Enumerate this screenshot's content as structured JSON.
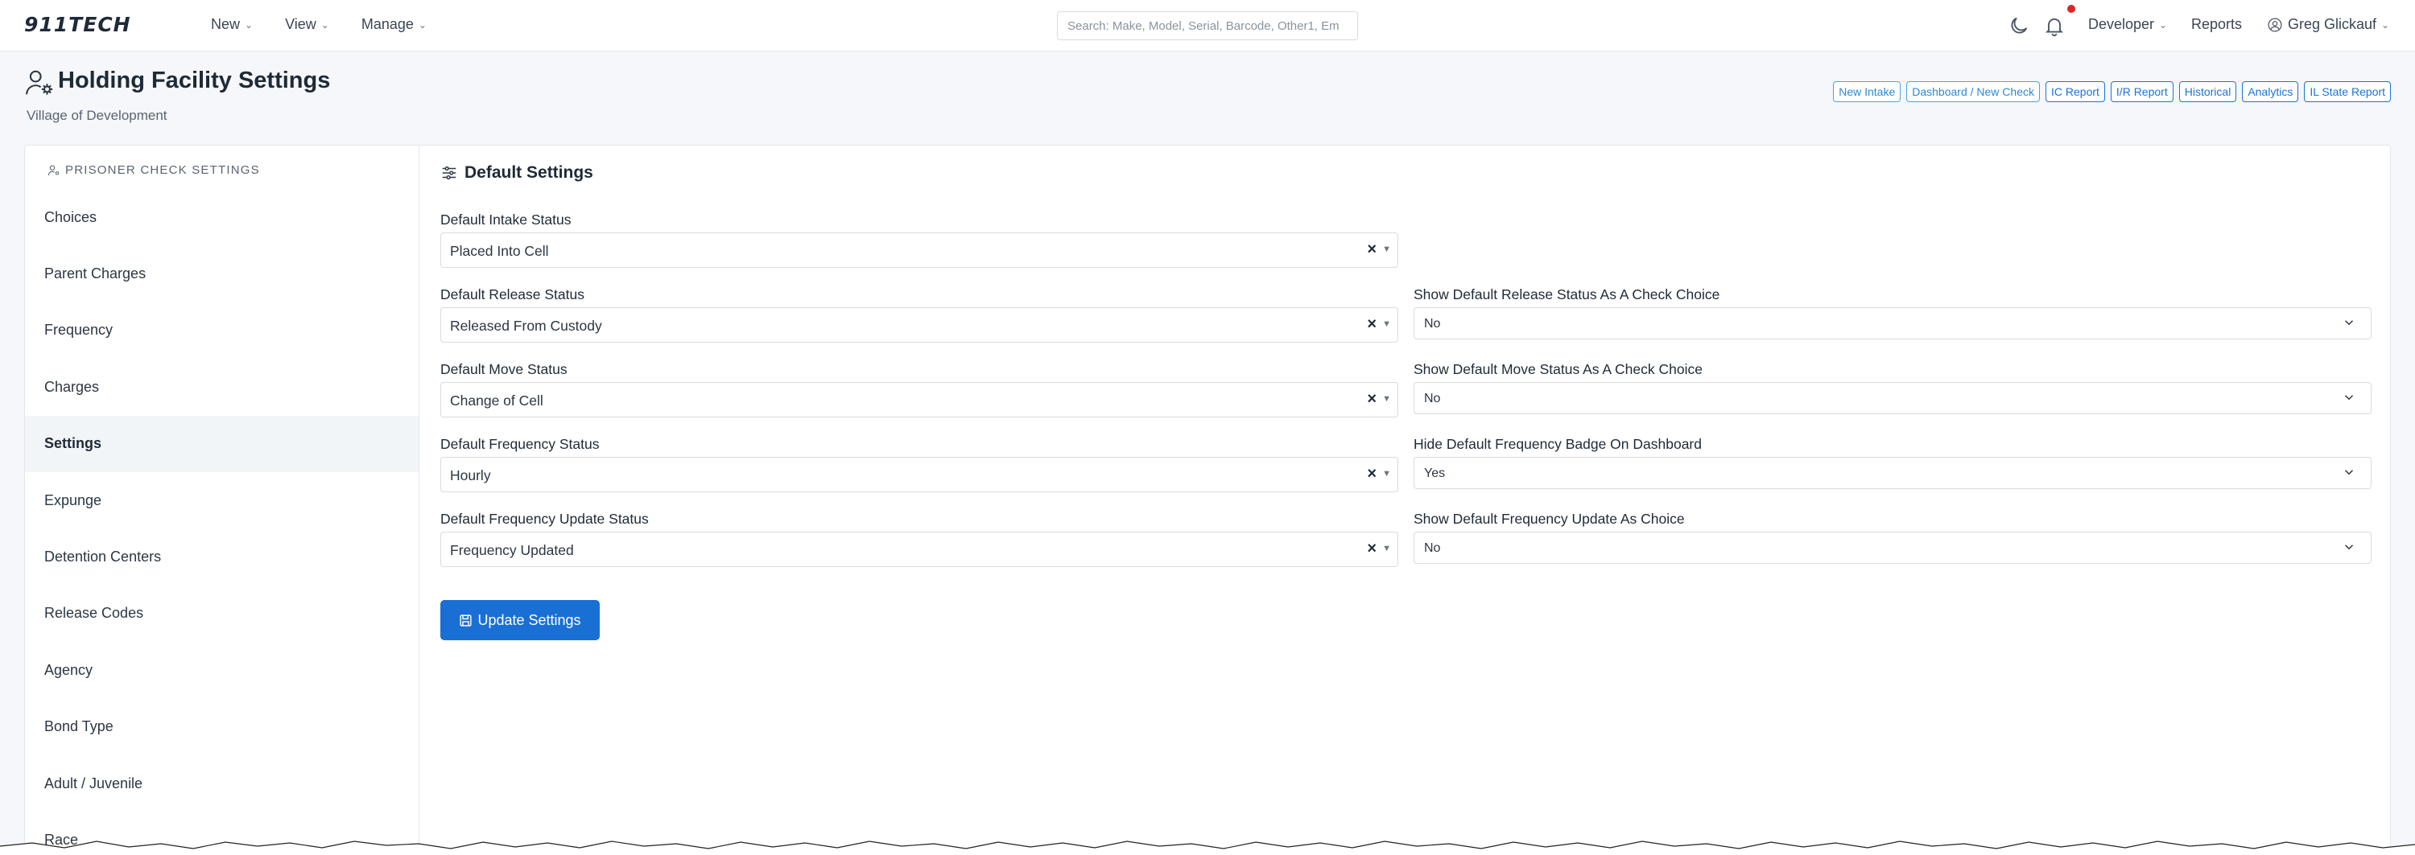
{
  "nav": {
    "logo": "911TECH",
    "menu": [
      "New",
      "View",
      "Manage"
    ],
    "search_placeholder": "Search: Make, Model, Serial, Barcode, Other1, Em",
    "developer": "Developer",
    "reports": "Reports",
    "user": "Greg Glickauf"
  },
  "page": {
    "title": "Holding Facility Settings",
    "subtitle": "Village of Development",
    "quick_links": [
      "New Intake",
      "Dashboard / New Check",
      "IC Report",
      "I/R Report",
      "Historical",
      "Analytics",
      "IL State Report"
    ]
  },
  "sidebar": {
    "header": "PRISONER CHECK SETTINGS",
    "items": [
      "Choices",
      "Parent Charges",
      "Frequency",
      "Charges",
      "Settings",
      "Expunge",
      "Detention Centers",
      "Release Codes",
      "Agency",
      "Bond Type",
      "Adult / Juvenile",
      "Race"
    ],
    "active": "Settings"
  },
  "content": {
    "title": "Default Settings",
    "intake_label": "Default Intake Status",
    "intake_value": "Placed Into Cell",
    "release_label": "Default Release Status",
    "release_value": "Released From Custody",
    "move_label": "Default Move Status",
    "move_value": "Change of Cell",
    "freq_label": "Default Frequency Status",
    "freq_value": "Hourly",
    "freq_update_label": "Default Frequency Update Status",
    "freq_update_value": "Frequency Updated",
    "show_release_label": "Show Default Release Status As A Check Choice",
    "show_release_value": "No",
    "show_move_label": "Show Default Move Status As A Check Choice",
    "show_move_value": "No",
    "hide_freq_badge_label": "Hide Default Frequency Badge On Dashboard",
    "hide_freq_badge_value": "Yes",
    "show_freq_update_label": "Show Default Frequency Update As Choice",
    "show_freq_update_value": "No",
    "update_button": "Update Settings"
  },
  "icons": [
    "person-gear-icon",
    "moon-icon",
    "bell-icon",
    "user-circle-icon",
    "sliders-icon",
    "save-icon",
    "chevron-down-icon"
  ],
  "colors": {
    "accent": "#1a6fd4",
    "notification": "#e02424"
  }
}
